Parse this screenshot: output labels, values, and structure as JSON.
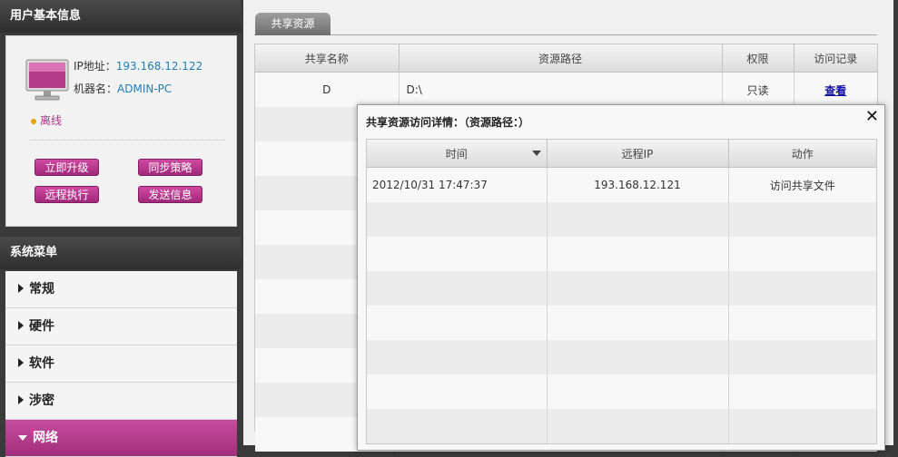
{
  "user_panel": {
    "title": "用户基本信息",
    "ip_label": "IP地址：",
    "ip_value": "193.168.12.122",
    "host_label": "机器名：",
    "host_value": "ADMIN-PC",
    "status": "离线",
    "buttons": {
      "upgrade": "立即升级",
      "sync": "同步策略",
      "remote": "远程执行",
      "message": "发送信息"
    }
  },
  "menu": {
    "title": "系统菜单",
    "items": [
      "常规",
      "硬件",
      "软件",
      "涉密",
      "网络"
    ],
    "active_index": 4
  },
  "tabs": [
    {
      "label": "共享资源",
      "active": true
    }
  ],
  "share_table": {
    "columns": [
      "共享名称",
      "资源路径",
      "权限",
      "访问记录"
    ],
    "rows": [
      {
        "name": "D",
        "path": "D:\\",
        "permission": "只读",
        "record": "查看"
      }
    ]
  },
  "dialog": {
    "title": "共享资源访问详情：（资源路径：）",
    "columns": [
      "时间",
      "远程IP",
      "动作"
    ],
    "rows": [
      {
        "time": "2012/10/31 17:47:37",
        "remote_ip": "193.168.12.121",
        "action": "访问共享文件"
      }
    ]
  },
  "colors": {
    "accent": "#b0308a",
    "link": "#1f7fb3",
    "status_dot": "#e8a200"
  }
}
